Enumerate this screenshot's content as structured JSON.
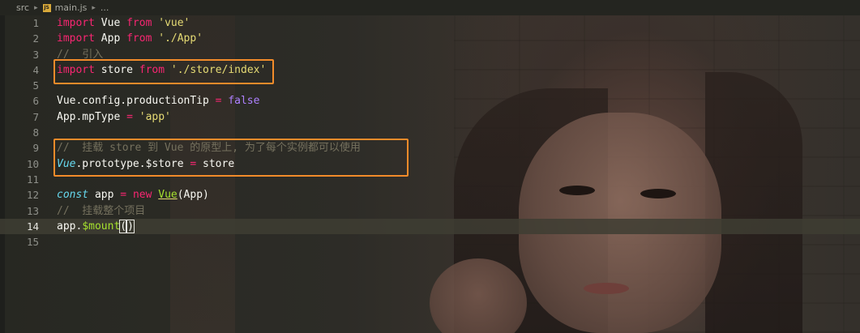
{
  "breadcrumb": {
    "folder": "src",
    "file": "main.js",
    "tail": "...",
    "file_badge": "JS"
  },
  "editor": {
    "active_line": 14,
    "lines": [
      {
        "n": "1",
        "tokens": [
          {
            "t": "import",
            "c": "kw"
          },
          {
            "t": " Vue ",
            "c": "plain"
          },
          {
            "t": "from",
            "c": "kw"
          },
          {
            "t": " ",
            "c": "plain"
          },
          {
            "t": "'vue'",
            "c": "str"
          }
        ]
      },
      {
        "n": "2",
        "tokens": [
          {
            "t": "import",
            "c": "kw"
          },
          {
            "t": " App ",
            "c": "plain"
          },
          {
            "t": "from",
            "c": "kw"
          },
          {
            "t": " ",
            "c": "plain"
          },
          {
            "t": "'./App'",
            "c": "str"
          }
        ]
      },
      {
        "n": "3",
        "tokens": [
          {
            "t": "//  引入",
            "c": "cm"
          }
        ]
      },
      {
        "n": "4",
        "tokens": [
          {
            "t": "import",
            "c": "kw"
          },
          {
            "t": " store ",
            "c": "plain"
          },
          {
            "t": "from",
            "c": "kw"
          },
          {
            "t": " ",
            "c": "plain"
          },
          {
            "t": "'./store/index'",
            "c": "str"
          }
        ]
      },
      {
        "n": "5",
        "tokens": []
      },
      {
        "n": "6",
        "tokens": [
          {
            "t": "Vue.config.productionTip ",
            "c": "plain"
          },
          {
            "t": "=",
            "c": "kw"
          },
          {
            "t": " ",
            "c": "plain"
          },
          {
            "t": "false",
            "c": "bool"
          }
        ]
      },
      {
        "n": "7",
        "tokens": [
          {
            "t": "App.mpType ",
            "c": "plain"
          },
          {
            "t": "=",
            "c": "kw"
          },
          {
            "t": " ",
            "c": "plain"
          },
          {
            "t": "'app'",
            "c": "str"
          }
        ]
      },
      {
        "n": "8",
        "tokens": []
      },
      {
        "n": "9",
        "tokens": [
          {
            "t": "//  挂载 store 到 Vue 的原型上, 为了每个实例都可以使用",
            "c": "cm"
          }
        ]
      },
      {
        "n": "10",
        "tokens": [
          {
            "t": "Vue",
            "c": "typ"
          },
          {
            "t": ".prototype.$store ",
            "c": "plain"
          },
          {
            "t": "=",
            "c": "kw"
          },
          {
            "t": " store",
            "c": "plain"
          }
        ]
      },
      {
        "n": "11",
        "tokens": []
      },
      {
        "n": "12",
        "tokens": [
          {
            "t": "const",
            "c": "typ"
          },
          {
            "t": " app ",
            "c": "plain"
          },
          {
            "t": "=",
            "c": "kw"
          },
          {
            "t": " ",
            "c": "plain"
          },
          {
            "t": "new",
            "c": "kw"
          },
          {
            "t": " ",
            "c": "plain"
          },
          {
            "t": "Vue",
            "c": "fn und"
          },
          {
            "t": "(App)",
            "c": "plain"
          }
        ]
      },
      {
        "n": "13",
        "tokens": [
          {
            "t": "//  挂载整个项目",
            "c": "cm"
          }
        ]
      },
      {
        "n": "14",
        "tokens": [
          {
            "t": "app.",
            "c": "plain"
          },
          {
            "t": "$mount",
            "c": "fn"
          },
          {
            "t": "(",
            "c": "plain paren-box"
          },
          {
            "t": ")",
            "c": "plain paren-box cursor"
          }
        ]
      },
      {
        "n": "15",
        "tokens": []
      }
    ]
  },
  "colors": {
    "highlight_border": "#f28b2a",
    "keyword": "#f92672",
    "string": "#e6db74",
    "comment": "#75715e",
    "boolean": "#ae81ff",
    "function": "#a6e22e",
    "type": "#66d9ef"
  }
}
